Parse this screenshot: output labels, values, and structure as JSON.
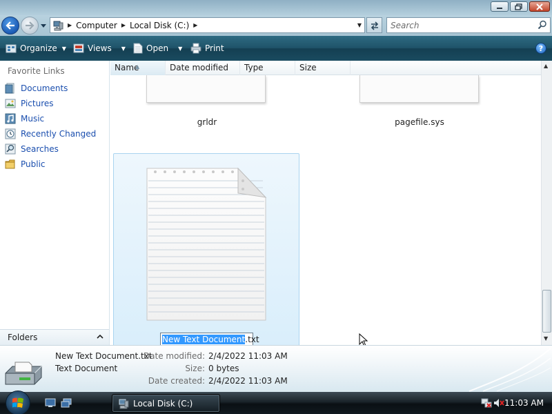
{
  "address": {
    "crumbs": [
      "Computer",
      "Local Disk (C:)"
    ],
    "search_placeholder": "Search"
  },
  "toolbar": {
    "organize": "Organize",
    "views": "Views",
    "open": "Open",
    "print": "Print"
  },
  "nav": {
    "heading": "Favorite Links",
    "items": [
      {
        "label": "Documents",
        "icon": "documents-icon"
      },
      {
        "label": "Pictures",
        "icon": "pictures-icon"
      },
      {
        "label": "Music",
        "icon": "music-icon"
      },
      {
        "label": "Recently Changed",
        "icon": "recently-changed-icon"
      },
      {
        "label": "Searches",
        "icon": "searches-icon"
      },
      {
        "label": "Public",
        "icon": "public-folder-icon"
      }
    ],
    "folders": "Folders"
  },
  "columns": [
    "Name",
    "Date modified",
    "Type",
    "Size"
  ],
  "files": [
    {
      "name": "grldr"
    },
    {
      "name": "pagefile.sys"
    }
  ],
  "rename": {
    "selected_part": "New Text Document",
    "extension": ".txt"
  },
  "details": {
    "name": "New Text Document.txt",
    "type": "Text Document",
    "labels": {
      "modified": "Date modified:",
      "size": "Size:",
      "created": "Date created:"
    },
    "values": {
      "modified": "2/4/2022 11:03 AM",
      "size": "0 bytes",
      "created": "2/4/2022 11:03 AM"
    }
  },
  "taskbar": {
    "window_button": "Local Disk (C:)",
    "clock": "11:03 AM"
  },
  "colors": {
    "toolbar": "#1f5369",
    "link": "#1a4eae",
    "selection": "#3399ff"
  }
}
